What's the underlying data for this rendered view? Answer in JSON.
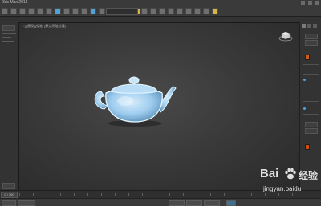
{
  "window": {
    "title": "3ds Max 2018"
  },
  "toolbar": {
    "selection_set": ""
  },
  "viewport": {
    "label": "[+] [透视] [标准] [默认明暗处理]"
  },
  "timeline": {
    "frame": "0 / 100"
  },
  "watermark": {
    "brand_prefix": "Bai",
    "brand_suffix": "经验",
    "url": "jingyan.baidu"
  },
  "colors": {
    "accent": "#4fa3d9",
    "teapot": "#a9d6f4",
    "viewport_bg": "#3a3a3a",
    "swatch": "#d25a1a"
  }
}
